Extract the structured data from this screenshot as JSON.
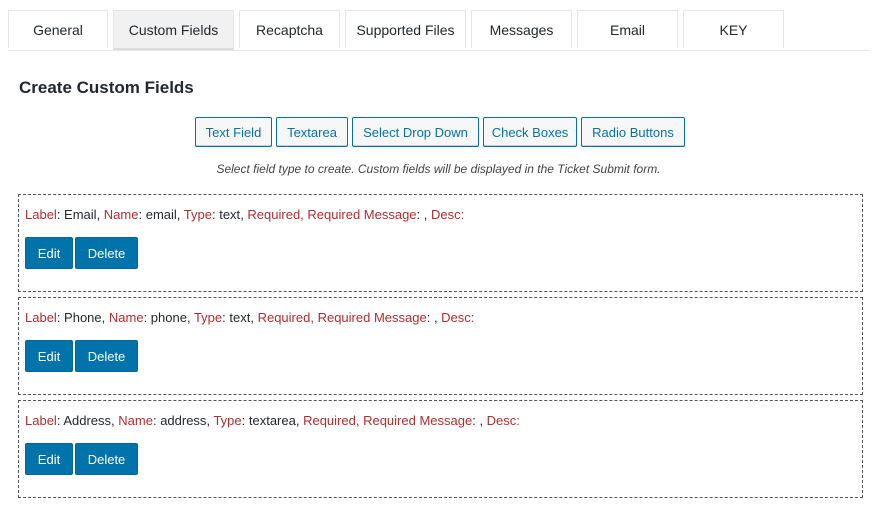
{
  "tabs": [
    {
      "label": "General"
    },
    {
      "label": "Custom Fields",
      "active": true
    },
    {
      "label": "Recaptcha"
    },
    {
      "label": "Supported Files"
    },
    {
      "label": "Messages"
    },
    {
      "label": "Email"
    },
    {
      "label": "KEY"
    }
  ],
  "section_title": "Create Custom Fields",
  "field_type_buttons": [
    {
      "label": "Text Field"
    },
    {
      "label": "Textarea"
    },
    {
      "label": "Select Drop Down"
    },
    {
      "label": "Check Boxes"
    },
    {
      "label": "Radio Buttons"
    }
  ],
  "help_text": "Select field type to create. Custom fields will be displayed in the Ticket Submit form.",
  "keys": {
    "label": "Label",
    "name": "Name",
    "type": "Type",
    "required": "Required,",
    "required_message": "Required Message",
    "desc": "Desc:"
  },
  "fields": [
    {
      "label": "Email",
      "name": "email",
      "type": "text",
      "required_message": ""
    },
    {
      "label": "Phone",
      "name": "phone",
      "type": "text",
      "required_message": ""
    },
    {
      "label": "Address",
      "name": "address",
      "type": "textarea",
      "required_message": ""
    }
  ],
  "actions": {
    "edit": "Edit",
    "delete": "Delete"
  },
  "colors": {
    "primary_button": "#0073aa",
    "key_text": "#b32d2e"
  }
}
